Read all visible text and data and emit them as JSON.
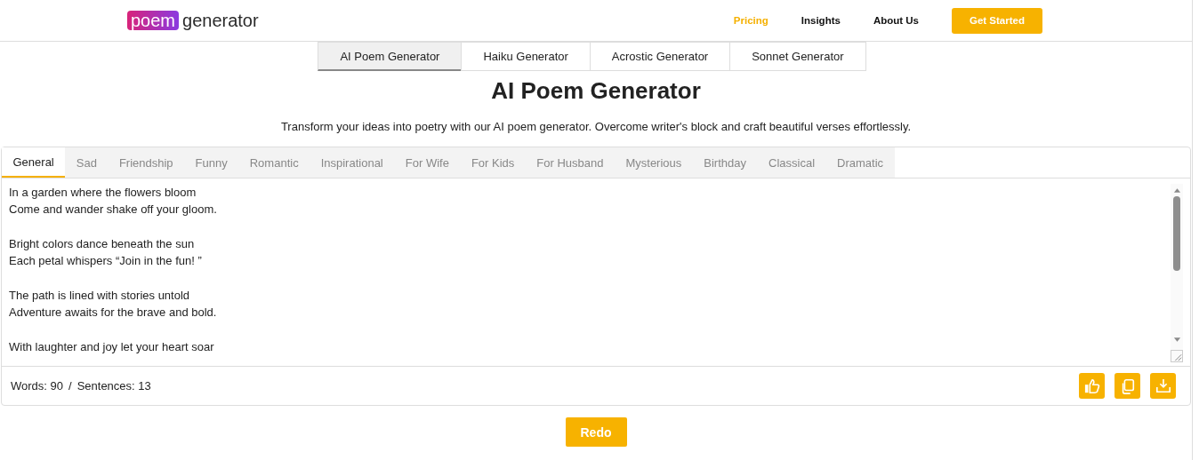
{
  "header": {
    "logo": {
      "mark": "poem",
      "wordmark": "generator"
    },
    "nav": [
      {
        "label": "Pricing",
        "selected": true
      },
      {
        "label": "Insights",
        "selected": false
      },
      {
        "label": "About Us",
        "selected": false
      }
    ],
    "cta": "Get Started"
  },
  "tool_tabs": [
    {
      "label": "AI Poem Generator",
      "selected": true
    },
    {
      "label": "Haiku Generator",
      "selected": false
    },
    {
      "label": "Acrostic Generator",
      "selected": false
    },
    {
      "label": "Sonnet Generator",
      "selected": false
    }
  ],
  "title": "AI Poem Generator",
  "subtitle": "Transform your ideas into poetry with our AI poem generator. Overcome writer's block and craft beautiful verses effortlessly.",
  "category_tabs": [
    {
      "label": "General",
      "selected": true
    },
    {
      "label": "Sad",
      "selected": false
    },
    {
      "label": "Friendship",
      "selected": false
    },
    {
      "label": "Funny",
      "selected": false
    },
    {
      "label": "Romantic",
      "selected": false
    },
    {
      "label": "Inspirational",
      "selected": false
    },
    {
      "label": "For Wife",
      "selected": false
    },
    {
      "label": "For Kids",
      "selected": false
    },
    {
      "label": "For Husband",
      "selected": false
    },
    {
      "label": "Mysterious",
      "selected": false
    },
    {
      "label": "Birthday",
      "selected": false
    },
    {
      "label": "Classical",
      "selected": false
    },
    {
      "label": "Dramatic",
      "selected": false
    }
  ],
  "poem": "In a garden where the flowers bloom\nCome and wander shake off your gloom.\n\nBright colors dance beneath the sun\nEach petal whispers “Join in the fun! ”\n\nThe path is lined with stories untold\nAdventure awaits for the brave and bold.\n\nWith laughter and joy let your heart soar",
  "stats": {
    "words": "Words: 90",
    "separator": "/",
    "sentences": "Sentences: 13"
  },
  "redo": "Redo"
}
